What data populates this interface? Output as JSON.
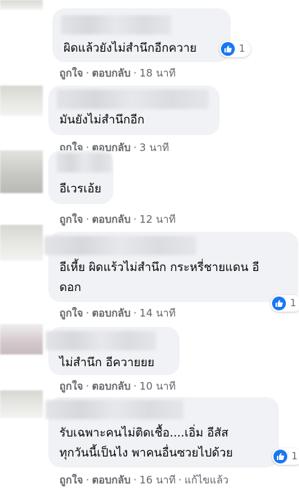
{
  "comments": [
    {
      "text": "ผิดแล้วยังไม่สำนึกอีกควาย",
      "like": "ถูกใจ",
      "reply": "ตอบกลับ",
      "time": "18 นาที",
      "reactions": "1"
    },
    {
      "text": "มันยังไม่สำนึกอีก",
      "like": "ถูกใจ",
      "reply": "ตอบกลับ",
      "time": "3 นาที"
    },
    {
      "text": "อีเวรเอ้ย",
      "like": "ถูกใจ",
      "reply": "ตอบกลับ",
      "time": "12 นาที"
    },
    {
      "text": "อีเหี้ย ผิดแร้วไม่สำนึก กระหรี่ชายแดน อี\nดอก",
      "like": "ถูกใจ",
      "reply": "ตอบกลับ",
      "time": "14 นาที",
      "reactions": "1"
    },
    {
      "text": "ไม่สำนึก อีควายยย",
      "like": "ถูกใจ",
      "reply": "ตอบกลับ",
      "time": "10 นาที"
    },
    {
      "text": "รับเฉพาะคนไม่ติดเชื้อ....เอิ่ม อีสัส\nทุกวันนี้เป็นไง พาคนอื่นซวยไปด้วย",
      "like": "ถูกใจ",
      "reply": "ตอบกลับ",
      "time": "16 นาที",
      "edited": "แก้ไขแล้ว",
      "reactions": "1"
    }
  ],
  "separator": "·",
  "icon": "like-thumb-icon",
  "colors": {
    "bubble": "#f0f2f5",
    "meta": "#65676b",
    "like": "#1877f2"
  }
}
